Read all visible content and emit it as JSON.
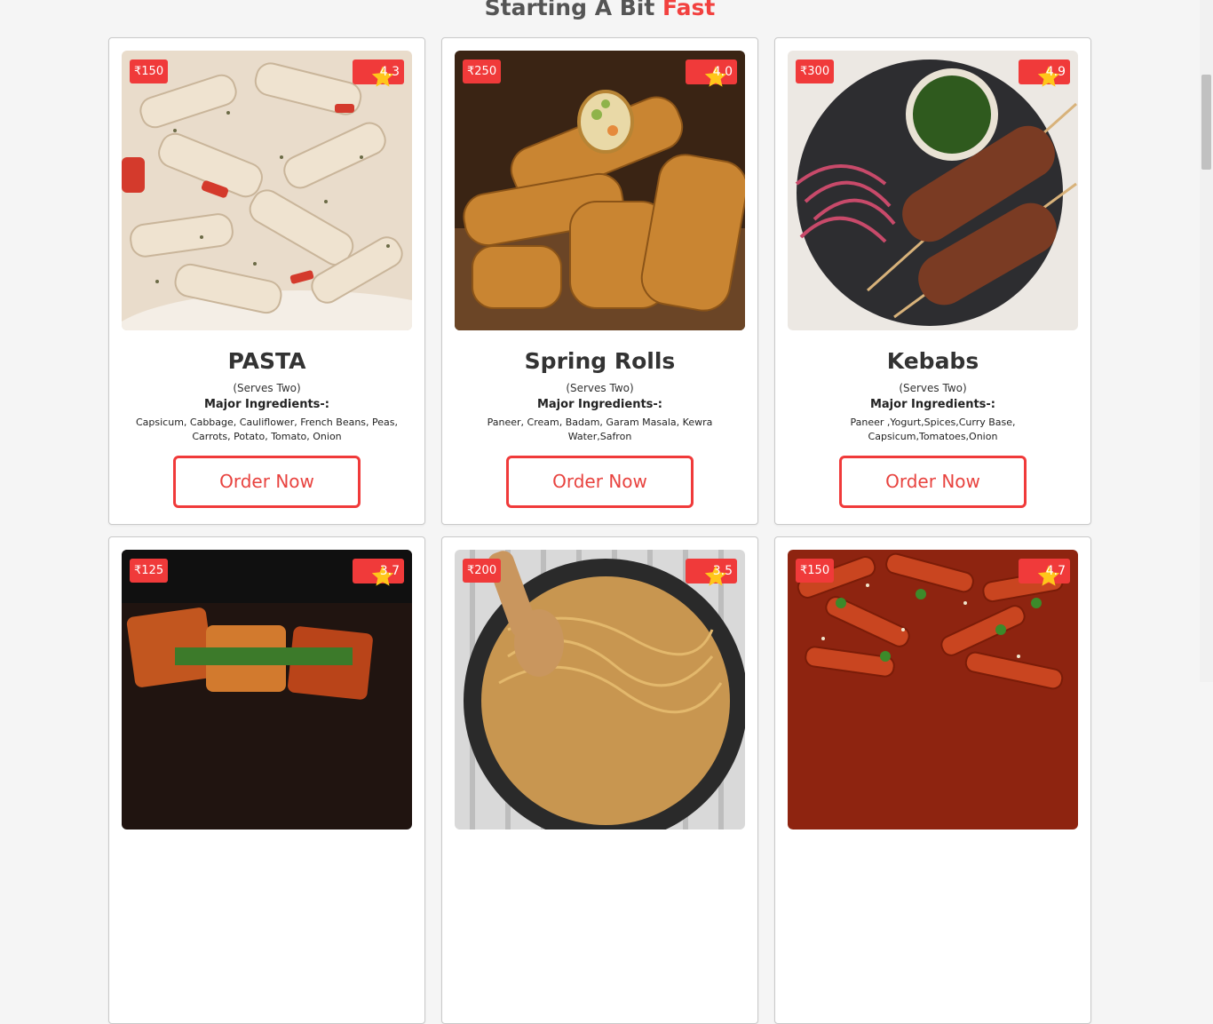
{
  "section": {
    "title_prefix": "Starting A Bit",
    "title_accent": "Fast"
  },
  "colors": {
    "accent": "#f03a3a",
    "text": "#333333",
    "background": "#f5f5f5"
  },
  "icons": {
    "rating": "star-icon"
  },
  "cards": [
    {
      "name": "PASTA",
      "price": "₹150",
      "rating": "4.3",
      "serves": "(Serves Two)",
      "ingredients_title": "Major Ingredients-:",
      "ingredients": "Capsicum, Cabbage, Cauliflower, French Beans, Peas, Carrots, Potato, Tomato, Onion",
      "button": "Order Now"
    },
    {
      "name": "Spring Rolls",
      "price": "₹250",
      "rating": "4.0",
      "serves": "(Serves Two)",
      "ingredients_title": "Major Ingredients-:",
      "ingredients": "Paneer, Cream, Badam, Garam Masala, Kewra Water,Safron",
      "button": "Order Now"
    },
    {
      "name": "Kebabs",
      "price": "₹300",
      "rating": "4.9",
      "serves": "(Serves Two)",
      "ingredients_title": "Major Ingredients-:",
      "ingredients": "Paneer ,Yogurt,Spices,Curry Base, Capsicum,Tomatoes,Onion",
      "button": "Order Now"
    },
    {
      "price": "₹125",
      "rating": "3.7"
    },
    {
      "price": "₹200",
      "rating": "3.5"
    },
    {
      "price": "₹150",
      "rating": "4.7"
    }
  ]
}
